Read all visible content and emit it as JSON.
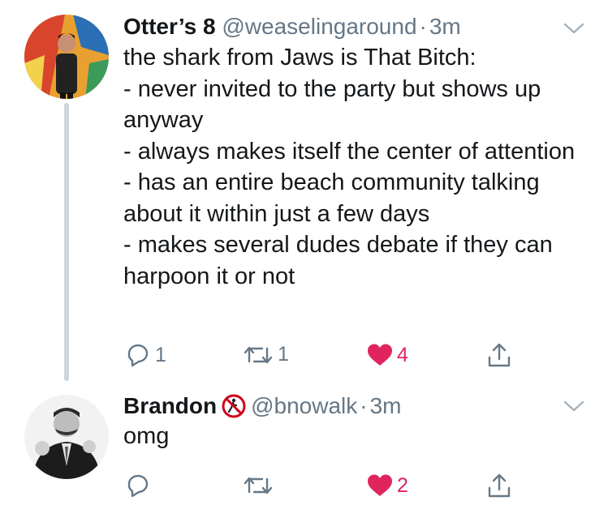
{
  "tweets": [
    {
      "display_name": "Otter’s 8",
      "handle": "@weaselingaround",
      "separator": "·",
      "time": "3m",
      "text": "the shark from Jaws is That Bitch:\n- never invited to the party but shows up anyway\n- always makes itself the center of attention\n- has an entire beach community talking about it within just a few days\n- makes several dudes debate if they can harpoon it or not",
      "replies": "1",
      "retweets": "1",
      "likes": "4",
      "liked": true
    },
    {
      "display_name": "Brandon",
      "badge_icon": "no-pedestrian-emoji-icon",
      "handle": "@bnowalk",
      "separator": "·",
      "time": "3m",
      "text": "omg",
      "replies": "",
      "retweets": "",
      "likes": "2",
      "liked": true
    }
  ],
  "colors": {
    "text": "#14171a",
    "secondary": "#657786",
    "like": "#e0245e",
    "thread_line": "#ccd6dd"
  }
}
